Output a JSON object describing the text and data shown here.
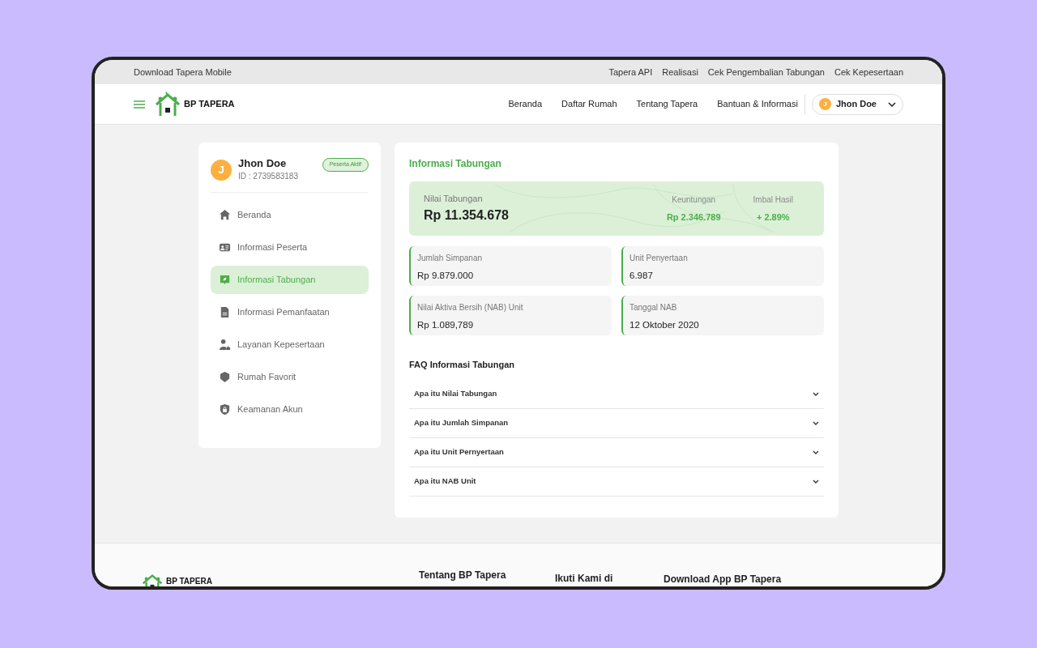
{
  "top_bar": {
    "left_link": "Download Tapera Mobile",
    "links": [
      "Tapera API",
      "Realisasi",
      "Cek Pengembalian Tabungan",
      "Cek Kepesertaan"
    ]
  },
  "nav": {
    "brand": "BP TAPERA",
    "links": [
      "Beranda",
      "Daftar Rumah",
      "Tentang Tapera",
      "Bantuan & Informasi"
    ],
    "user": {
      "initial": "J",
      "name": "Jhon Doe"
    }
  },
  "profile": {
    "initial": "J",
    "name": "Jhon Doe",
    "id": "ID : 2739583183",
    "badge": "Peserta Aktif"
  },
  "sidebar": {
    "items": [
      {
        "label": "Beranda",
        "kind": "home",
        "selected": false
      },
      {
        "label": "Informasi Peserta",
        "kind": "card",
        "selected": false
      },
      {
        "label": "Informasi Tabungan",
        "kind": "savings",
        "selected": true
      },
      {
        "label": "Informasi Pemanfaatan",
        "kind": "document",
        "selected": false
      },
      {
        "label": "Layanan Kepesertaan",
        "kind": "person",
        "selected": false
      },
      {
        "label": "Rumah Favorit",
        "kind": "favorite",
        "selected": false
      },
      {
        "label": "Keamanan Akun",
        "kind": "lock",
        "selected": false
      }
    ]
  },
  "main": {
    "title": "Informasi Tabungan",
    "summary": {
      "label": "Nilai Tabungan",
      "value": "Rp 11.354.678",
      "stats": [
        {
          "label": "Keuntungan",
          "value": "Rp 2.346.789"
        },
        {
          "label": "Imbal Hasil",
          "value": "+ 2.89%"
        }
      ]
    },
    "details": [
      {
        "label": "Jumlah Simpanan",
        "value": "Rp 9.879.000"
      },
      {
        "label": "Unit Penyertaan",
        "value": "6.987"
      },
      {
        "label": "Nilai Aktiva Bersih (NAB) Unit",
        "value": "Rp 1.089,789"
      },
      {
        "label": "Tanggal NAB",
        "value": "12 Oktober 2020"
      }
    ],
    "faq_title": "FAQ Informasi Tabungan",
    "faq": [
      {
        "question": "Apa itu Nilai Tabungan",
        "expanded": false
      },
      {
        "question": "Apa itu Jumlah Simpanan",
        "expanded": false
      },
      {
        "question": "Apa itu Unit Pernyertaan",
        "expanded": false
      },
      {
        "question": "Apa itu NAB Unit",
        "expanded": false
      }
    ]
  },
  "footer": {
    "brand": "BP TAPERA",
    "headings": [
      "Tentang BP Tapera",
      "Ikuti Kami di",
      "Download App BP Tapera"
    ]
  }
}
